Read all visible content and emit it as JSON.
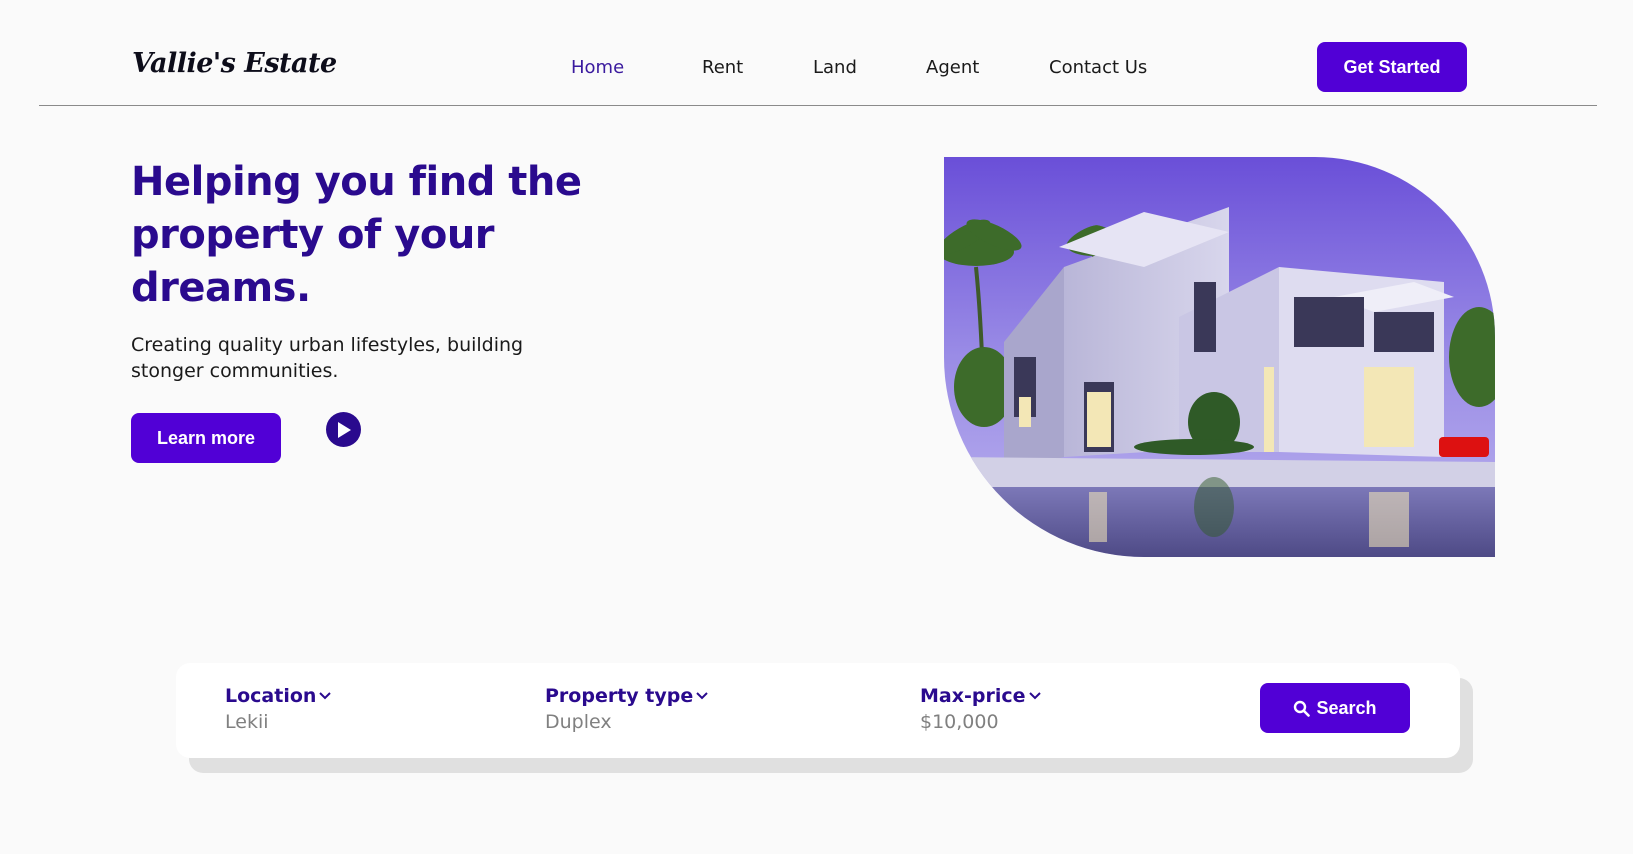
{
  "brand": {
    "name": "Vallie's Estate"
  },
  "nav": {
    "items": [
      {
        "label": "Home",
        "active": true
      },
      {
        "label": "Rent",
        "active": false
      },
      {
        "label": "Land",
        "active": false
      },
      {
        "label": "Agent",
        "active": false
      },
      {
        "label": "Contact Us",
        "active": false
      }
    ],
    "cta_label": "Get Started"
  },
  "hero": {
    "title": "Helping you find the property of your dreams.",
    "subtitle": "Creating quality urban lifestyles, building stonger communities.",
    "learn_more_label": "Learn more",
    "play_icon": "play-icon"
  },
  "search": {
    "location": {
      "label": "Location",
      "value": "Lekii"
    },
    "property_type": {
      "label": "Property type",
      "value": "Duplex"
    },
    "max_price": {
      "label": "Max-price",
      "value": "$10,000"
    },
    "button_label": "Search"
  },
  "colors": {
    "accent": "#5100d6",
    "heading": "#2a0a8e",
    "background": "#fafafa"
  }
}
